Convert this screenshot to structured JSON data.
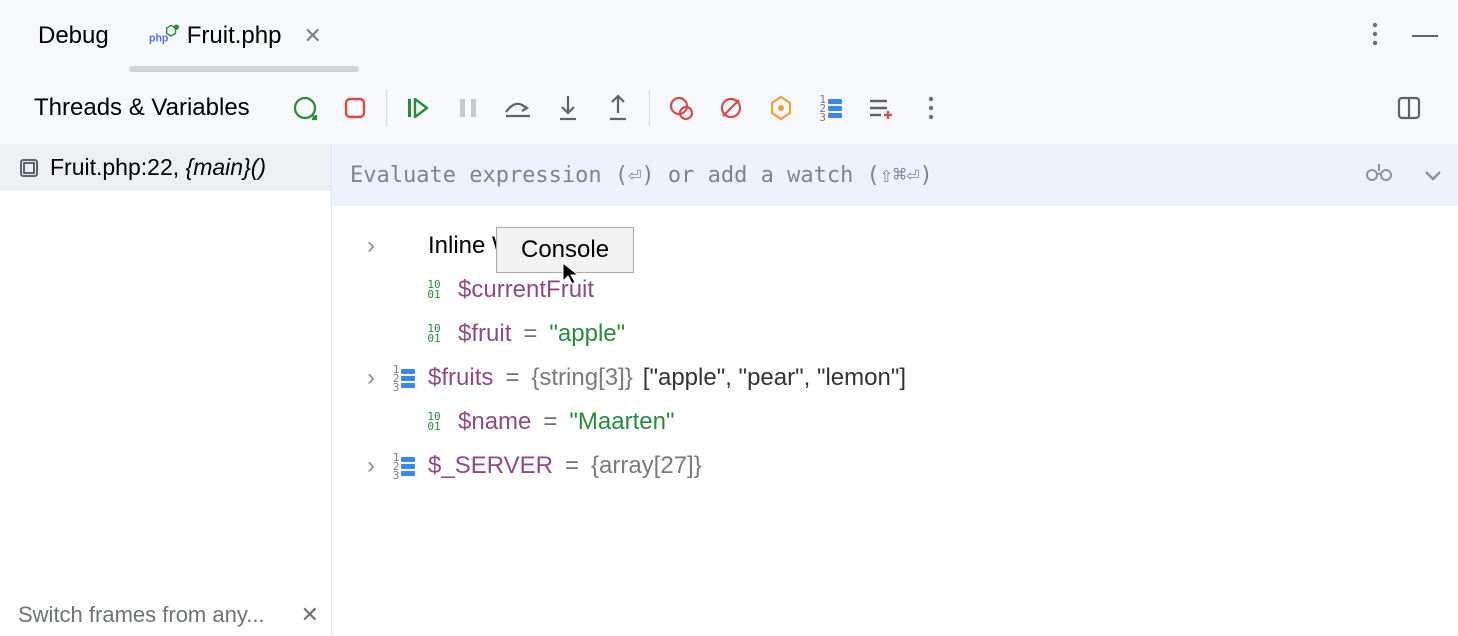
{
  "tabs": {
    "debug_label": "Debug",
    "file_label": "Fruit.php"
  },
  "toolbar": {
    "section_label": "Threads & Variables"
  },
  "frames": {
    "item0": {
      "location": "Fruit.php:22, ",
      "function": "{main}()"
    }
  },
  "status": {
    "text": "Switch frames from any..."
  },
  "evaluate": {
    "placeholder": "Evaluate expression (⏎) or add a watch (⇧⌘⏎)"
  },
  "tooltip": {
    "label": "Console"
  },
  "vars": {
    "inline_watches_label": "Inline Watches",
    "currentFruit": {
      "name": "$currentFruit",
      "eq": " = ",
      "value": "\"\""
    },
    "fruit": {
      "name": "$fruit",
      "eq": " = ",
      "value": "\"apple\""
    },
    "fruits": {
      "name": "$fruits",
      "eq": " = ",
      "type": "{string[3]}",
      "preview": " [\"apple\", \"pear\", \"lemon\"]"
    },
    "name": {
      "name": "$name",
      "eq": " = ",
      "value": "\"Maarten\""
    },
    "server": {
      "name": "$_SERVER",
      "eq": " = ",
      "type": "{array[27]}"
    }
  }
}
